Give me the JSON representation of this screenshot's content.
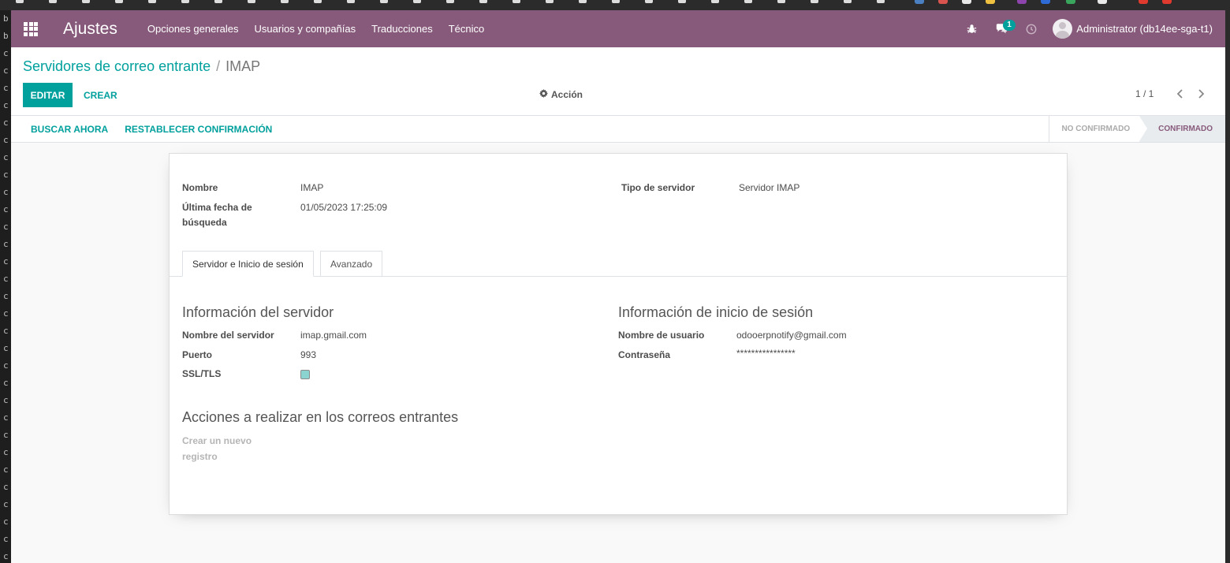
{
  "navbar": {
    "brand": "Ajustes",
    "menu": [
      "Opciones generales",
      "Usuarios y compañías",
      "Traducciones",
      "Técnico"
    ],
    "messages_badge": "1",
    "user_name": "Administrator (db14ee-sga-t1)"
  },
  "breadcrumb": {
    "parent": "Servidores de correo entrante",
    "separator": "/",
    "current": "IMAP"
  },
  "toolbar": {
    "edit_label": "EDITAR",
    "create_label": "CREAR",
    "action_label": "Acción",
    "pager": "1 / 1"
  },
  "statusbar": {
    "fetch_now": "BUSCAR AHORA",
    "reset_confirmation": "RESTABLECER CONFIRMACIÓN",
    "states": [
      "NO CONFIRMADO",
      "CONFIRMADO"
    ],
    "active_state": "CONFIRMADO"
  },
  "form": {
    "name_label": "Nombre",
    "name_value": "IMAP",
    "last_fetch_label": "Última fecha de búsqueda",
    "last_fetch_label_line1": "Última fecha de",
    "last_fetch_label_line2": "búsqueda",
    "last_fetch_value": "01/05/2023 17:25:09",
    "server_type_label": "Tipo de servidor",
    "server_type_value": "Servidor IMAP",
    "tabs": [
      "Servidor e Inicio de sesión",
      "Avanzado"
    ],
    "server_info_title": "Información del servidor",
    "server_name_label": "Nombre del servidor",
    "server_name_value": "imap.gmail.com",
    "port_label": "Puerto",
    "port_value": "993",
    "ssl_label": "SSL/TLS",
    "ssl_checked": true,
    "login_info_title": "Información de inicio de sesión",
    "username_label": "Nombre de usuario",
    "username_value": "odooerpnotify@gmail.com",
    "password_label": "Contraseña",
    "password_value": "****************",
    "actions_title": "Acciones a realizar en los correos entrantes",
    "create_record_label_line1": "Crear un nuevo",
    "create_record_label_line2": "registro"
  },
  "host_sidebar_chars": [
    "b",
    "b",
    "c",
    "c",
    "c",
    "c",
    "c",
    "c",
    "c",
    "c",
    "c",
    "c",
    "c",
    "c",
    "c",
    "c",
    "c",
    "c",
    "c",
    "c",
    "c",
    "c",
    "c",
    "c",
    "c",
    "c",
    "c",
    "c",
    "c",
    "c",
    "c",
    "c"
  ],
  "colors": {
    "navbar": "#875a7b",
    "primary": "#00a09d",
    "background": "#f9f9f9"
  },
  "icons": {
    "apps": "apps-grid-icon",
    "debug": "bug-icon",
    "messages": "chat-icon",
    "activities": "clock-icon",
    "action": "gear-icon",
    "prev": "chevron-left-icon",
    "next": "chevron-right-icon"
  }
}
